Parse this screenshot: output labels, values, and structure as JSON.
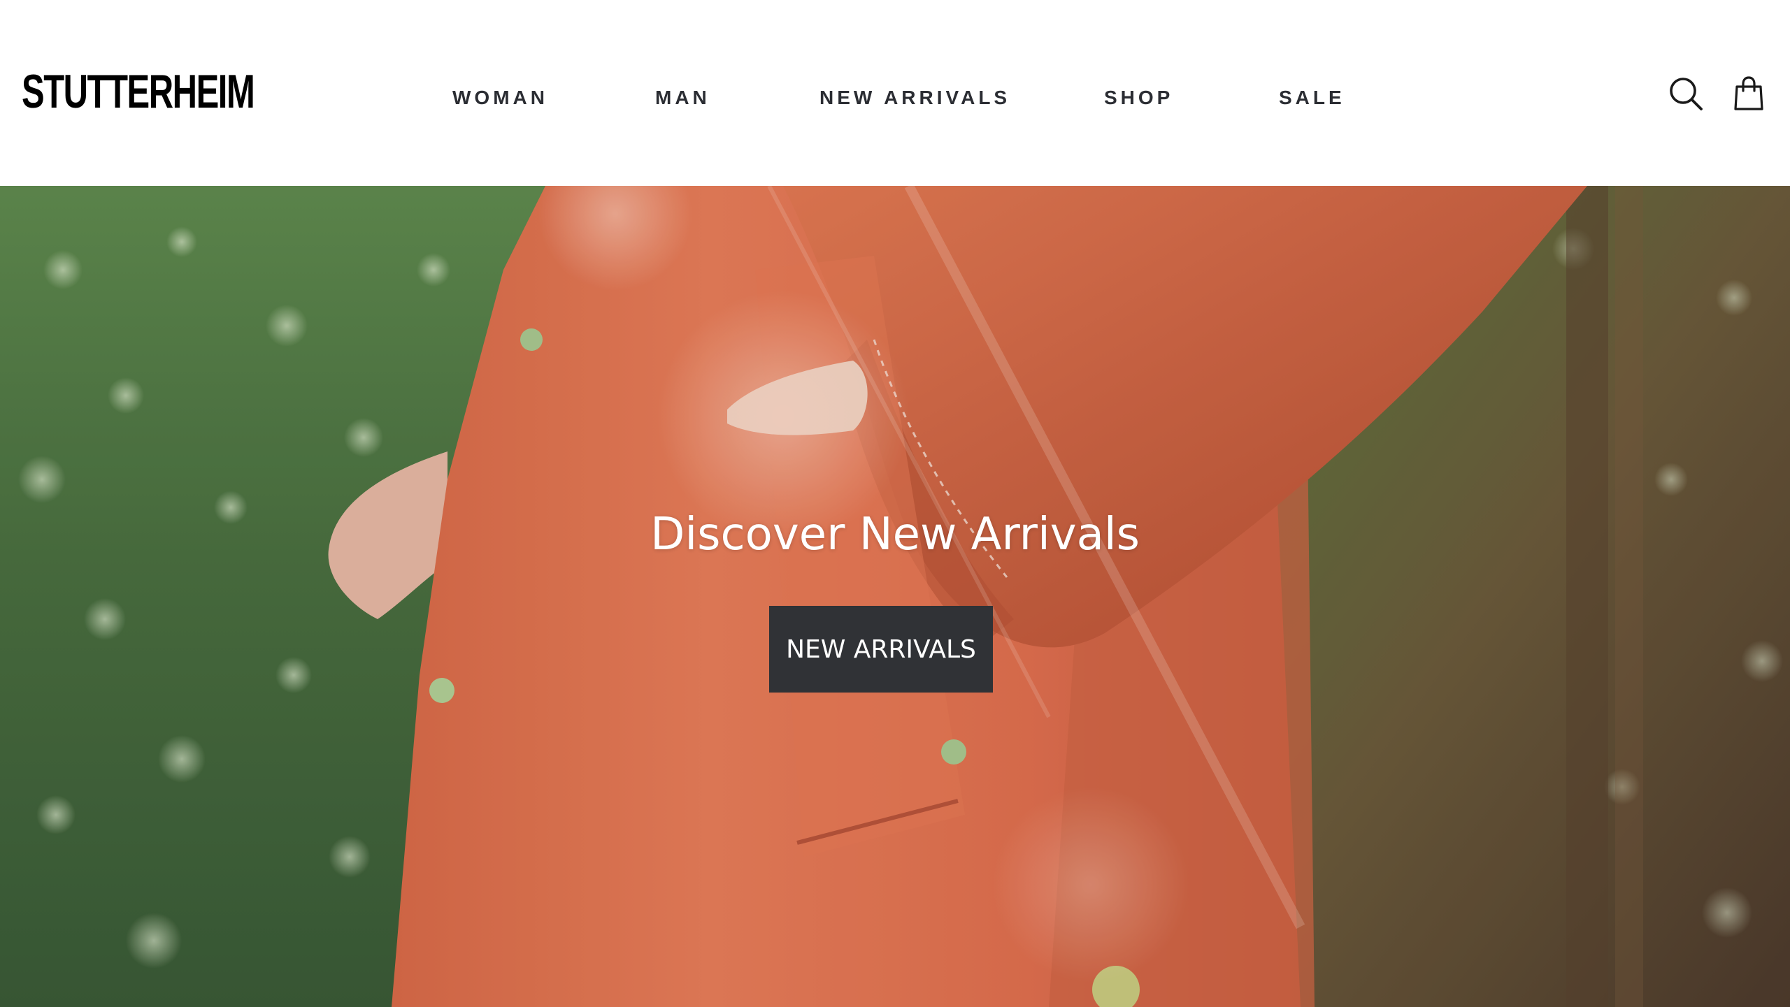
{
  "header": {
    "logo_text": "STUTTERHEIM",
    "nav": [
      {
        "label": "WOMAN"
      },
      {
        "label": "MAN"
      },
      {
        "label": "NEW ARRIVALS"
      },
      {
        "label": "SHOP"
      },
      {
        "label": "SALE"
      }
    ],
    "icons": {
      "search": "search-icon",
      "bag": "shopping-bag-icon"
    }
  },
  "hero": {
    "title": "Discover New Arrivals",
    "cta_label": "NEW ARRIVALS",
    "image": "photo of person in orange raincoat in forest"
  },
  "colors": {
    "nav_text": "#2b2d33",
    "cta_bg": "#303236",
    "coat": "#e0714e",
    "foliage": "#4d7a3e"
  }
}
